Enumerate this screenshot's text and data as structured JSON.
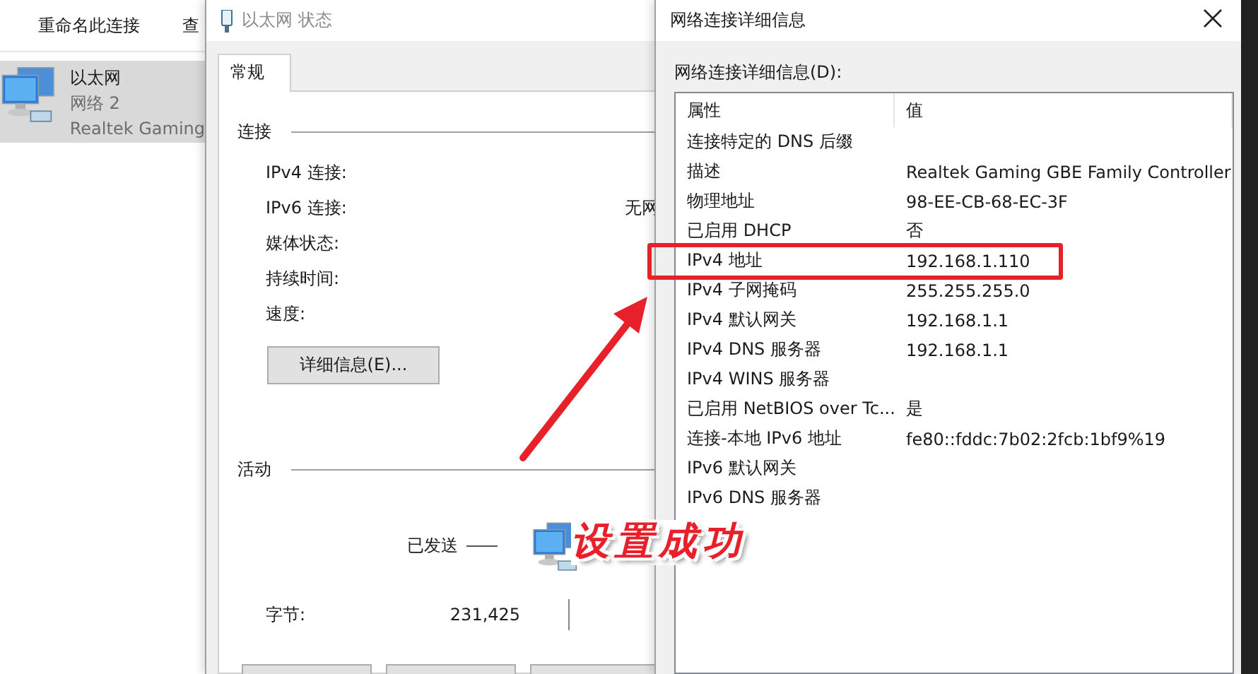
{
  "explorer": {
    "toolbar": [
      "重命名此连接",
      "查"
    ],
    "connections": [
      {
        "name": "以太网",
        "network": "网络 2",
        "adapter": "Realtek Gaming",
        "selected": true
      }
    ]
  },
  "status_dialog": {
    "title": "以太网 状态",
    "tabs": [
      {
        "label": "常规",
        "selected": true
      }
    ],
    "connection_group": "连接",
    "connection_rows": [
      {
        "label": "IPv4 连接:",
        "value": ""
      },
      {
        "label": "IPv6 连接:",
        "value": "无网"
      },
      {
        "label": "媒体状态:",
        "value": ""
      },
      {
        "label": "持续时间:",
        "value": ""
      },
      {
        "label": "速度:",
        "value": ""
      }
    ],
    "details_button": "详细信息(E)...",
    "activity_group": "活动",
    "sent_label": "已发送",
    "bytes_label": "字节:",
    "bytes_sent": "231,425"
  },
  "details_dialog": {
    "title": "网络连接详细信息",
    "list_label": "网络连接详细信息(D):",
    "columns": [
      "属性",
      "值"
    ],
    "rows": [
      [
        "连接特定的 DNS 后缀",
        ""
      ],
      [
        "描述",
        "Realtek Gaming GBE Family Controller"
      ],
      [
        "物理地址",
        "98-EE-CB-68-EC-3F"
      ],
      [
        "已启用 DHCP",
        "否"
      ],
      [
        "IPv4 地址",
        "192.168.1.110"
      ],
      [
        "IPv4 子网掩码",
        "255.255.255.0"
      ],
      [
        "IPv4 默认网关",
        "192.168.1.1"
      ],
      [
        "IPv4 DNS 服务器",
        "192.168.1.1"
      ],
      [
        "IPv4 WINS 服务器",
        ""
      ],
      [
        "已启用 NetBIOS over Tc...",
        "是"
      ],
      [
        "连接-本地 IPv6 地址",
        "fe80::fddc:7b02:2fcb:1bf9%19"
      ],
      [
        "IPv6 默认网关",
        ""
      ],
      [
        "IPv6 DNS 服务器",
        ""
      ]
    ]
  },
  "annotation": {
    "caption": "设置成功"
  }
}
